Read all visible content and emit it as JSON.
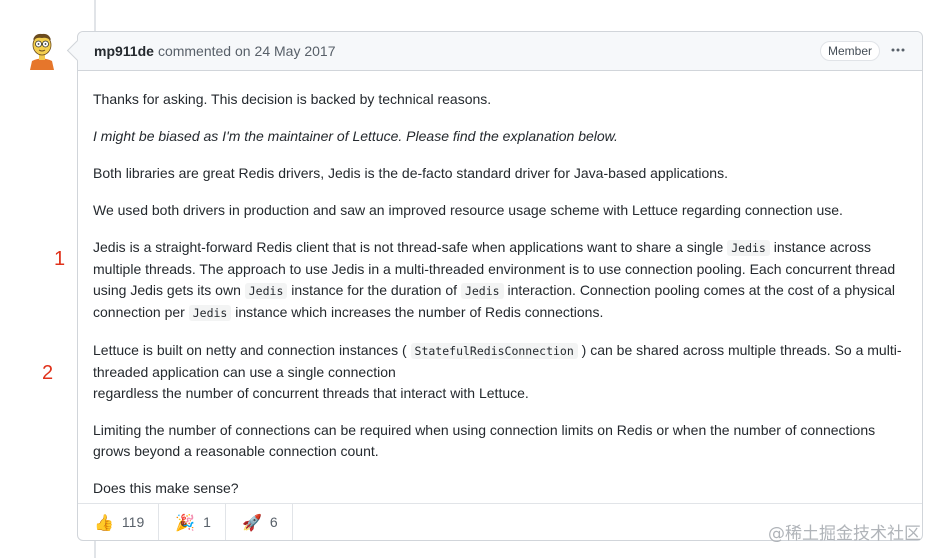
{
  "comment": {
    "author": "mp911de",
    "action": "commented on",
    "date": "24 May 2017",
    "badge": "Member",
    "menu_icon": "kebab-horizontal-icon"
  },
  "annotations": {
    "one": "1",
    "two": "2"
  },
  "body": {
    "p1": "Thanks for asking. This decision is backed by technical reasons.",
    "p2": "I might be biased as I'm the maintainer of Lettuce. Please find the explanation below.",
    "p3": "Both libraries are great Redis drivers, Jedis is the de-facto standard driver for Java-based applications.",
    "p4": "We used both drivers in production and saw an improved resource usage scheme with Lettuce regarding connection use.",
    "p5": {
      "a": "Jedis is a straight-forward Redis client that is not thread-safe when applications want to share a single ",
      "code1": "Jedis",
      "b": " instance across multiple threads. The approach to use Jedis in a multi-threaded environment is to use connection pooling. Each concurrent thread using Jedis gets its own ",
      "code2": "Jedis",
      "c": " instance for the duration of ",
      "code3": "Jedis",
      "d": " interaction. Connection pooling comes at the cost of a physical connection per ",
      "code4": "Jedis",
      "e": " instance which increases the number of Redis connections."
    },
    "p6": {
      "a": "Lettuce is built on netty and connection instances ( ",
      "code1": "StatefulRedisConnection",
      "b": " ) can be shared across multiple threads. So a multi-threaded application can use a single connection",
      "c": "regardless the number of concurrent threads that interact with Lettuce."
    },
    "p7": "Limiting the number of connections can be required when using connection limits on Redis or when the number of connections grows beyond a reasonable connection count.",
    "p8": "Does this make sense?"
  },
  "reactions": [
    {
      "icon": "thumbs-up-icon",
      "glyph": "👍",
      "count": "119"
    },
    {
      "icon": "tada-icon",
      "glyph": "🎉",
      "count": "1"
    },
    {
      "icon": "rocket-icon",
      "glyph": "🚀",
      "count": "6"
    }
  ],
  "watermark": "@稀土掘金技术社区"
}
